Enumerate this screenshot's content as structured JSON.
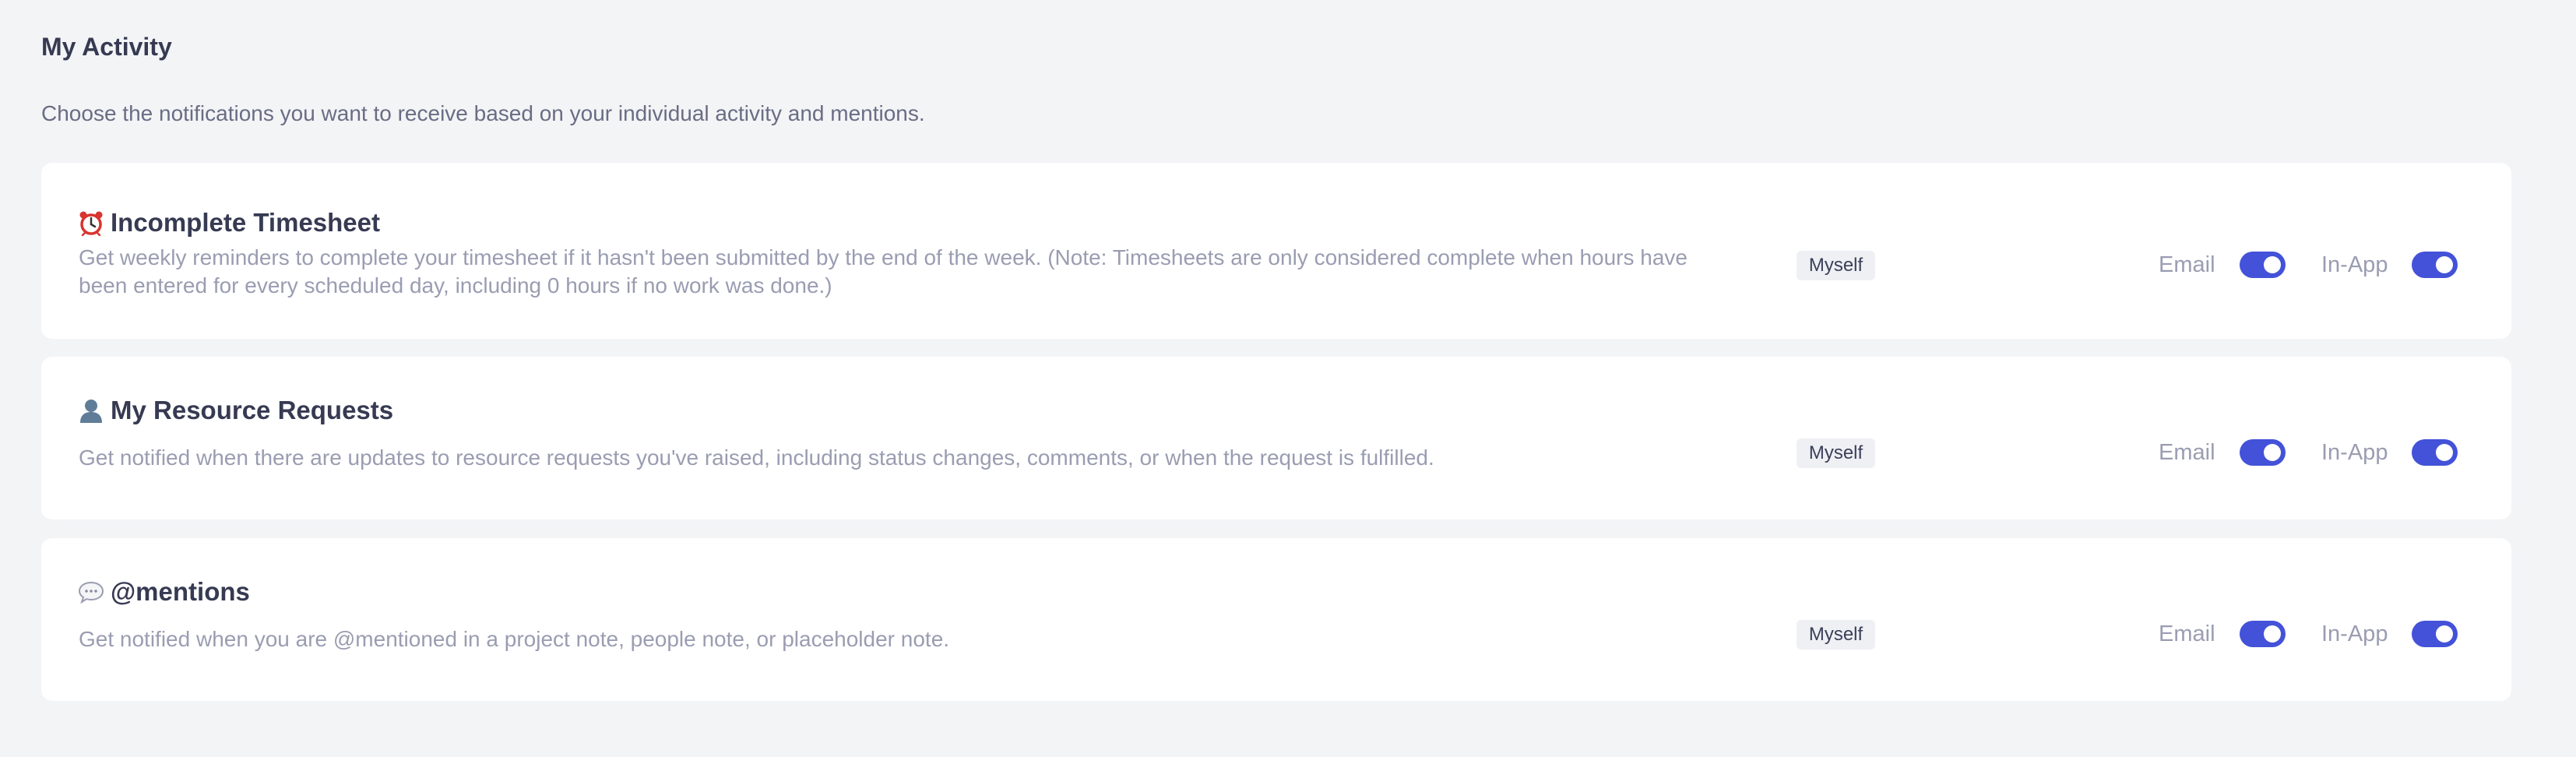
{
  "section": {
    "title": "My Activity",
    "description": "Choose the notifications you want to receive based on your individual activity and mentions."
  },
  "notifications": [
    {
      "icon": "alarm-clock-icon",
      "title": "Incomplete Timesheet",
      "description": "Get weekly reminders to complete your timesheet if it hasn't been submitted by the end of the week. (Note: Timesheets are only considered complete when hours have been entered for every scheduled day, including 0 hours if no work was done.)",
      "scope": "Myself",
      "email_label": "Email",
      "email_enabled": true,
      "inapp_label": "In-App",
      "inapp_enabled": true
    },
    {
      "icon": "person-icon",
      "title": "My Resource Requests",
      "description": "Get notified when there are updates to resource requests you've raised, including status changes, comments, or when the request is fulfilled.",
      "scope": "Myself",
      "email_label": "Email",
      "email_enabled": true,
      "inapp_label": "In-App",
      "inapp_enabled": true
    },
    {
      "icon": "speech-bubble-icon",
      "title": "@mentions",
      "description": "Get notified when you are @mentioned in a project note, people note, or placeholder note.",
      "scope": "Myself",
      "email_label": "Email",
      "email_enabled": true,
      "inapp_label": "In-App",
      "inapp_enabled": true
    }
  ],
  "colors": {
    "toggle_on": "#4352d8",
    "page_background": "#f3f4f6",
    "card_background": "#ffffff"
  }
}
